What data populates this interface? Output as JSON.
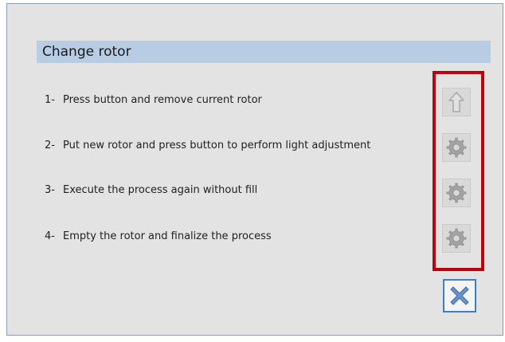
{
  "dialog": {
    "title": "Change rotor",
    "steps": [
      {
        "number": "1-",
        "text": "Press button and remove current rotor",
        "icon": "arrow-up-icon"
      },
      {
        "number": "2-",
        "text": "Put new rotor and press button to perform light adjustment",
        "icon": "gear-icon"
      },
      {
        "number": "3-",
        "text": "Execute the process again without fill",
        "icon": "gear-icon"
      },
      {
        "number": "4-",
        "text": "Empty the rotor and finalize the process",
        "icon": "gear-icon"
      }
    ],
    "close_icon": "close-x-icon"
  },
  "colors": {
    "title_bar": "#b8cce4",
    "highlight": "#c0000b",
    "close_border": "#3d7fc9",
    "close_x": "#5b8cc4",
    "icon_gray": "#9e9e9e"
  }
}
